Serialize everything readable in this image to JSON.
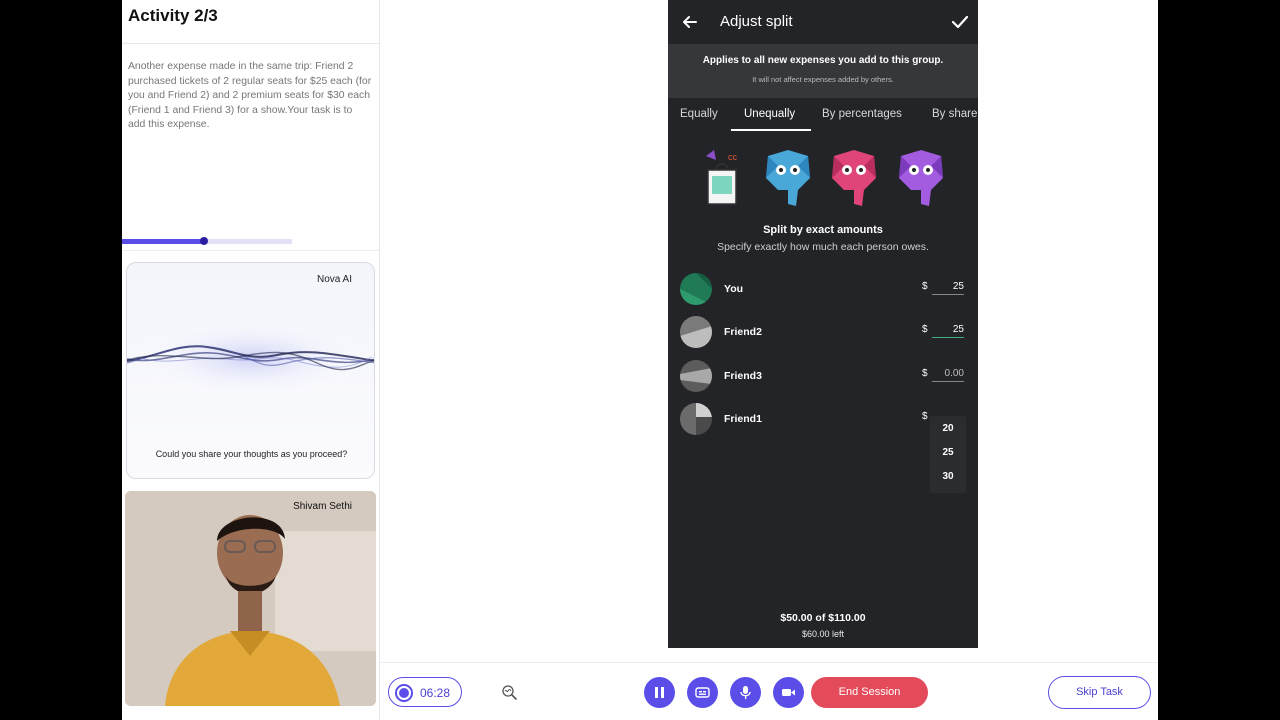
{
  "activity": {
    "title": "Activity 2/3",
    "task": "Another expense made in the same trip: Friend 2 purchased tickets of 2 regular seats for $25 each (for you and Friend 2) and 2 premium seats for $30 each (Friend 1 and Friend 3) for a show.Your task is to add this expense.",
    "progress_fraction": 0.48
  },
  "ai": {
    "name": "Nova AI",
    "question": "Could you share your thoughts as you proceed?"
  },
  "participant": {
    "name": "Shivam Sethi"
  },
  "phone": {
    "title": "Adjust split",
    "notice_main": "Applies to all new expenses you add to this group.",
    "notice_sub": "It will not affect expenses added by others.",
    "tabs": [
      {
        "label": "Equally"
      },
      {
        "label": "Unequally"
      },
      {
        "label": "By percentages"
      },
      {
        "label": "By share"
      }
    ],
    "split_title": "Split by exact amounts",
    "split_sub": "Specify exactly how much each person owes.",
    "currency": "$",
    "people": [
      {
        "name": "You",
        "amount": "25"
      },
      {
        "name": "Friend2",
        "amount": "25"
      },
      {
        "name": "Friend3",
        "amount": "0.00"
      },
      {
        "name": "Friend1",
        "amount": ""
      }
    ],
    "suggestions": [
      "20",
      "25",
      "30"
    ],
    "total": "$50.00 of $110.00",
    "left": "$60.00 left"
  },
  "controls": {
    "timer": "06:28",
    "end_label": "End Session",
    "skip_label": "Skip Task"
  },
  "colors": {
    "accent": "#5b4ee8",
    "end": "#e34a5a",
    "phone_bg": "#232427"
  }
}
